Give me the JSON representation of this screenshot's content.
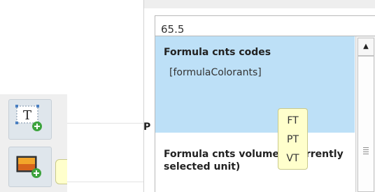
{
  "left_toolbar": {
    "tools": [
      {
        "name": "Add text",
        "icon": "text-add-icon"
      },
      {
        "name": "Add image",
        "icon": "image-add-icon"
      }
    ],
    "tooltip": "Add text"
  },
  "field": {
    "value": "65.5"
  },
  "column_header_fragment": "P",
  "dropdown": {
    "options": [
      {
        "title": "Formula cnts codes",
        "code": "[formulaColorants]",
        "selected": true
      },
      {
        "title": "Formula cnts volumes (currently selected unit)",
        "selected": false
      }
    ],
    "scrollbar": {
      "up_arrow": "▲"
    }
  },
  "suggestions": [
    "FT",
    "PT",
    "VT"
  ],
  "colors": {
    "selected_option": "#bde0f7",
    "tooltip_background": "#ffffcc",
    "toolbar_button": "#dfe6ec"
  }
}
